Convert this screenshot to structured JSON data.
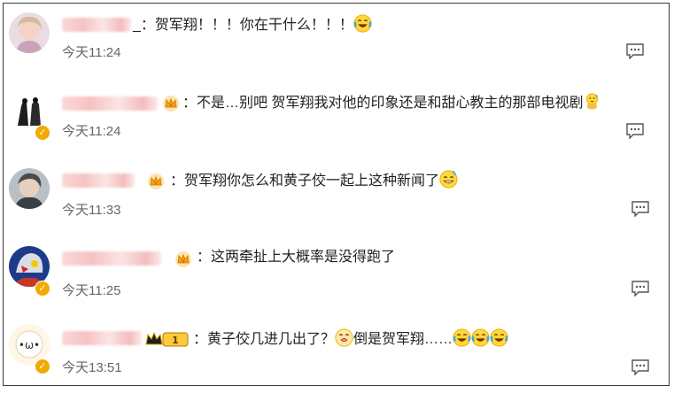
{
  "comments": [
    {
      "text_a": "_：贺军翔！！！你在干什么！！！",
      "time": "今天11:24"
    },
    {
      "text_a": "：不是…别吧 贺军翔我对他的印象还是和甜心教主的那部电视剧",
      "time": "今天11:24"
    },
    {
      "text_a": "：贺军翔你怎么和黄子佼一起上这种新闻了",
      "time": "今天11:33"
    },
    {
      "text_a": "：这两牵扯上大概率是没得跑了",
      "time": "今天11:25"
    },
    {
      "text_a": "：黄子佼几进几出了？",
      "text_b": "倒是贺军翔……",
      "time": "今天13:51",
      "vip_level": "1"
    }
  ],
  "icons": {
    "reply": "comment-reply-icon",
    "crown": "crown-icon",
    "verified": "verified-badge-icon",
    "emoji_laugh_cry": "laugh-cry-emoji",
    "emoji_sweat": "sweat-emoji",
    "emoji_grin": "grin-emoji",
    "emoji_zipped": "zipped-mouth-emoji"
  },
  "colors": {
    "verified": "#f2a900",
    "time": "#666666",
    "text": "#222222"
  }
}
